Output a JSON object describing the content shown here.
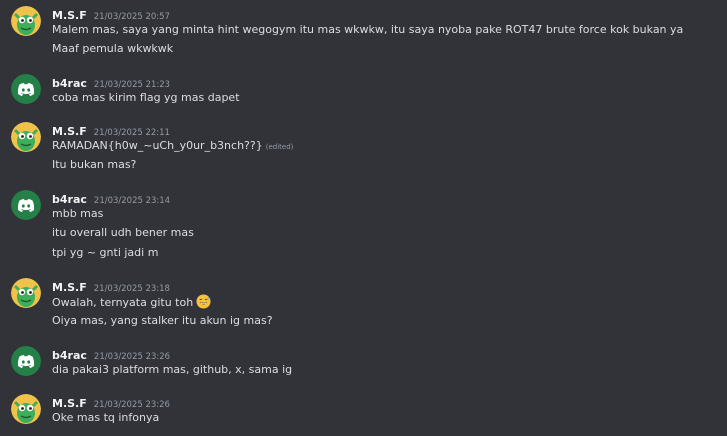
{
  "messages": [
    {
      "author": "M.S.F",
      "avatar": "green-creature-avatar-icon",
      "timestamp": "21/03/2025 20:57",
      "lines": [
        "Malem mas, saya yang minta hint wegogym itu mas wkwkw, itu saya nyoba pake ROT47 brute force kok bukan ya",
        "Maaf pemula wkwkwk"
      ]
    },
    {
      "author": "b4rac",
      "avatar": "discord-logo-avatar-icon",
      "timestamp": "21/03/2025 21:23",
      "lines": [
        "coba mas kirim flag yg mas dapet"
      ]
    },
    {
      "author": "M.S.F",
      "avatar": "green-creature-avatar-icon",
      "timestamp": "21/03/2025 22:11",
      "lines": [
        "RAMADAN{h0w_~uCh_y0ur_b3nch??}",
        "Itu bukan mas?"
      ],
      "edited": "(edited)"
    },
    {
      "author": "b4rac",
      "avatar": "discord-logo-avatar-icon",
      "timestamp": "21/03/2025 23:14",
      "lines": [
        "mbb mas",
        "itu overall udh bener mas",
        "tpi yg ~ gnti jadi m"
      ]
    },
    {
      "author": "M.S.F",
      "avatar": "green-creature-avatar-icon",
      "timestamp": "21/03/2025 23:18",
      "lines": [
        "Owalah, ternyata gitu toh",
        "Oiya mas, yang stalker itu akun ig mas?"
      ],
      "emoji": "grinning-sweat-emoji-icon"
    },
    {
      "author": "b4rac",
      "avatar": "discord-logo-avatar-icon",
      "timestamp": "21/03/2025 23:26",
      "lines": [
        "dia pakai3 platform mas, github, x, sama ig"
      ]
    },
    {
      "author": "M.S.F",
      "avatar": "green-creature-avatar-icon",
      "timestamp": "21/03/2025 23:26",
      "lines": [
        "Oke mas tq infonya"
      ]
    }
  ],
  "colors": {
    "background": "#313338",
    "discord_avatar_bg": "#248046",
    "msf_avatar_bg": "#f0c24a",
    "text": "#dbdee1",
    "author": "#f2f3f5",
    "timestamp": "#949ba4"
  }
}
